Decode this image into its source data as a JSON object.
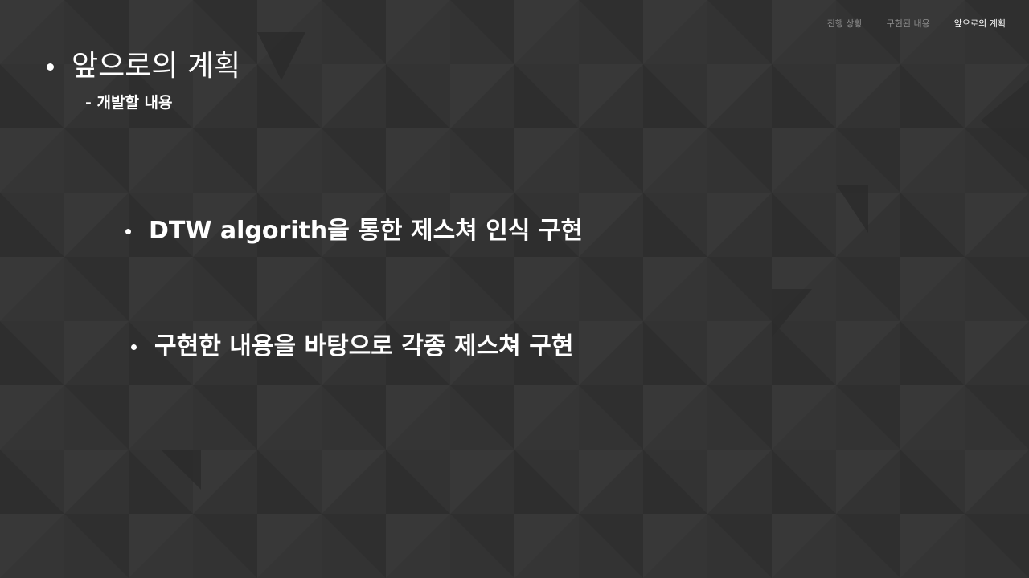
{
  "nav": {
    "items": [
      {
        "label": "진행 상황",
        "active": false
      },
      {
        "label": "구현된 내용",
        "active": false
      },
      {
        "label": "앞으로의 계획",
        "active": true
      }
    ]
  },
  "slide": {
    "title": "앞으로의 계획",
    "subtitle": "- 개발할 내용",
    "points": [
      "DTW algorith을 통한 제스쳐 인식 구현",
      "구현한 내용을 바탕으로 각종 제스쳐 구현"
    ]
  },
  "colors": {
    "background": "#333333",
    "text": "#ffffff",
    "nav_inactive": "#8c8c8c"
  }
}
